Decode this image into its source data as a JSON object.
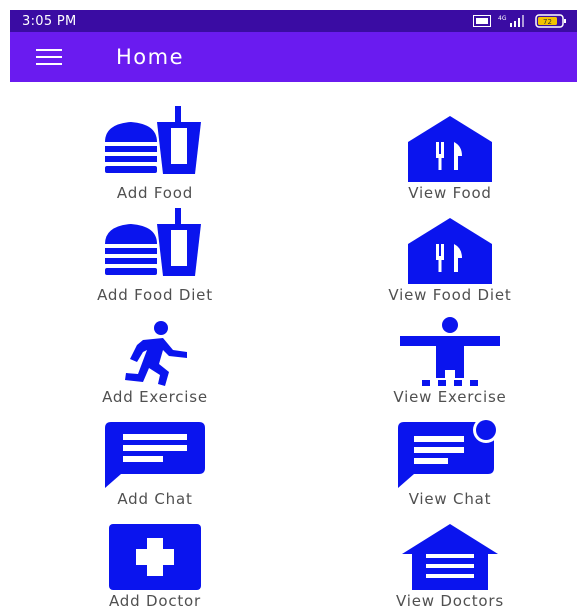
{
  "status_bar": {
    "time": "3:05 PM",
    "network": "4G",
    "battery": "72"
  },
  "app_bar": {
    "title": "Home"
  },
  "tiles": [
    {
      "label": "Add Food",
      "icon": "fastfood-icon"
    },
    {
      "label": "View Food",
      "icon": "restaurant-house-icon"
    },
    {
      "label": "Add Food Diet",
      "icon": "fastfood-icon"
    },
    {
      "label": "View Food Diet",
      "icon": "restaurant-house-icon"
    },
    {
      "label": "Add Exercise",
      "icon": "running-person-icon"
    },
    {
      "label": "View Exercise",
      "icon": "accessibility-person-icon"
    },
    {
      "label": "Add Chat",
      "icon": "chat-bubble-icon"
    },
    {
      "label": "View Chat",
      "icon": "chat-notification-icon"
    },
    {
      "label": "Add Doctor",
      "icon": "medical-cross-icon"
    },
    {
      "label": "View Doctors",
      "icon": "garage-house-icon"
    }
  ],
  "colors": {
    "status_bar": "#3a0ca3",
    "app_bar": "#6a1bf0",
    "icon": "#0a14ee",
    "label": "#505050"
  }
}
